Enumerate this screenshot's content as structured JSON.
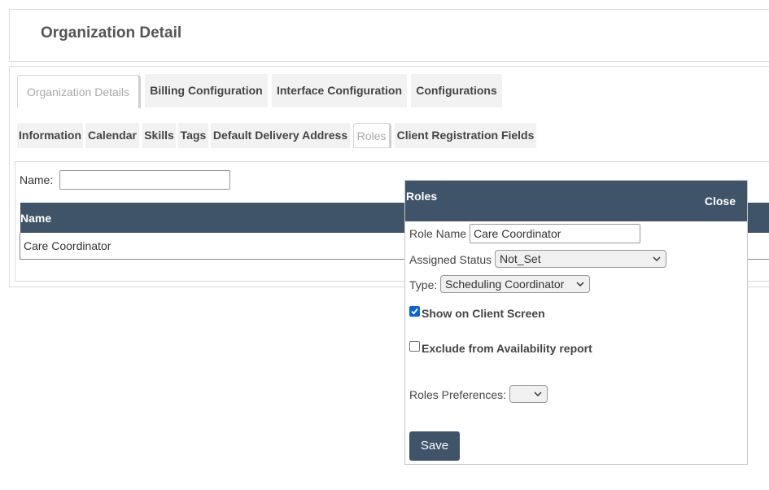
{
  "page": {
    "title": "Organization Detail"
  },
  "tabs": [
    {
      "label": "Organization Details",
      "active": true
    },
    {
      "label": "Billing Configuration"
    },
    {
      "label": "Interface Configuration"
    },
    {
      "label": "Configurations"
    }
  ],
  "subtabs": [
    {
      "label": "Information"
    },
    {
      "label": "Calendar"
    },
    {
      "label": "Skills"
    },
    {
      "label": "Tags"
    },
    {
      "label": "Default Delivery Address"
    },
    {
      "label": "Roles",
      "active": true
    },
    {
      "label": "Client Registration Fields"
    }
  ],
  "filter": {
    "name_label": "Name:",
    "name_value": ""
  },
  "grid": {
    "column_header": "Name",
    "rows": [
      "Care Coordinator"
    ]
  },
  "modal": {
    "title": "Roles",
    "close_label": "Close",
    "role_name_label": "Role Name",
    "role_name_value": "Care Coordinator",
    "assigned_status_label": "Assigned Status",
    "assigned_status_value": "Not_Set",
    "type_label": "Type:",
    "type_value": "Scheduling Coordinator",
    "show_on_client_label": "Show on Client Screen",
    "show_on_client_checked": true,
    "exclude_label": "Exclude from Availability report",
    "exclude_checked": false,
    "preferences_label": "Roles Preferences:",
    "preferences_value": "",
    "save_label": "Save"
  },
  "colors": {
    "header_bg": "#3f5369",
    "checkbox_accent": "#0a64d8"
  }
}
